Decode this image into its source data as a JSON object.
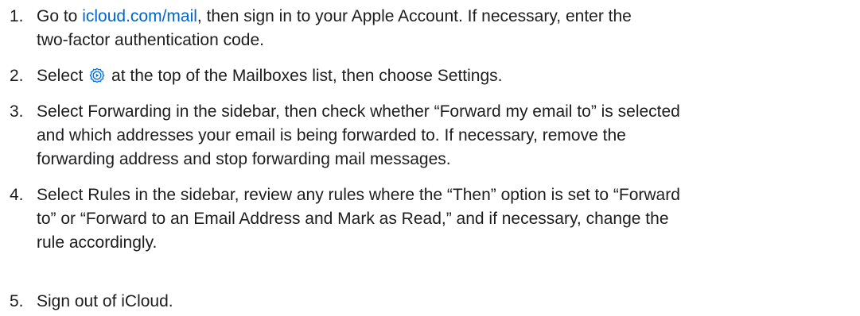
{
  "steps": [
    {
      "number": "1.",
      "before_link": "Go to ",
      "link": "icloud.com/mail",
      "after_link": ", then sign in to your Apple Account. If necessary, enter the",
      "line2": "two-factor authentication code."
    },
    {
      "number": "2.",
      "before_icon": "Select ",
      "icon": "settings-menu-icon",
      "after_icon": " at the top of the Mailboxes list, then choose Settings."
    },
    {
      "number": "3.",
      "line1": "Select Forwarding in the sidebar, then check whether “Forward my email to” is selected",
      "line2": "and which addresses your email is being forwarded to. If necessary, remove the",
      "line3": "forwarding address and stop forwarding mail messages."
    },
    {
      "number": "4.",
      "line1": "Select Rules in the sidebar, review any rules where the “Then” option is set to “Forward",
      "line2": "to” or “Forward to an Email Address and Mark as Read,” and if necessary, change the",
      "line3": "rule accordingly."
    },
    {
      "number": "5.",
      "line1": "Sign out of iCloud."
    }
  ],
  "colors": {
    "text": "#1d1d1f",
    "link": "#0066cc",
    "icon": "#0071e3"
  }
}
